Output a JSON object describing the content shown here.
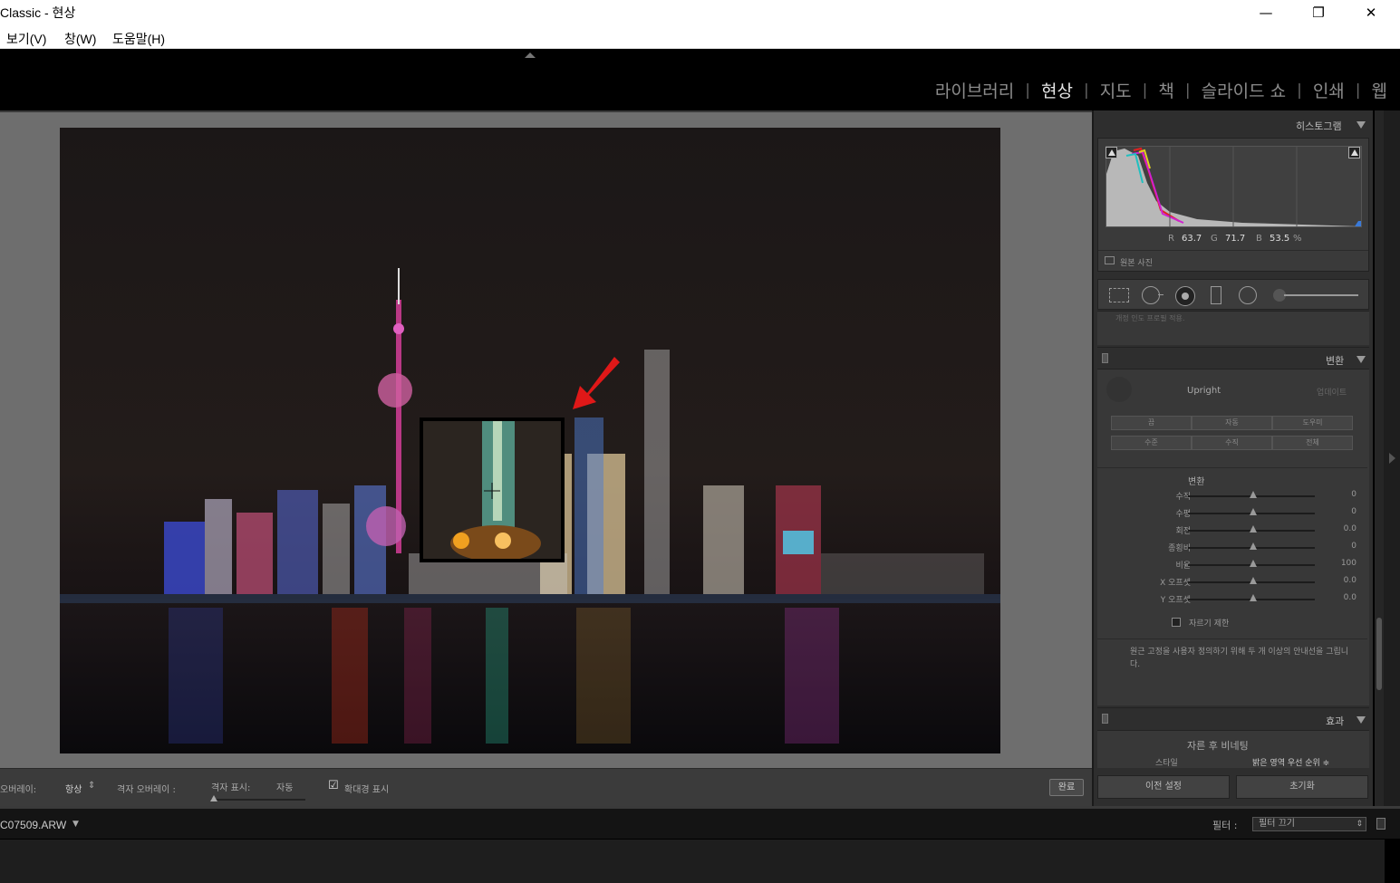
{
  "window": {
    "title": "Classic - 현상",
    "minimize_glyph": "—",
    "maximize_glyph": "❐",
    "close_glyph": "✕"
  },
  "menu": [
    "보기(V)",
    "창(W)",
    "도움말(H)"
  ],
  "modules": {
    "items": [
      "라이브러리",
      "현상",
      "지도",
      "책",
      "슬라이드 쇼",
      "인쇄",
      "웹"
    ],
    "active": "현상",
    "separator": "|"
  },
  "toolbar": {
    "overlay_label": "오버레이:",
    "overlay_value": "항상",
    "grid_overlay_label": "격자 오버레이 :",
    "grid_show_label": "격자 표시:",
    "grid_show_value": "자동",
    "loupe_label": "확대경 표시",
    "loupe_checked": true,
    "done_label": "완료"
  },
  "histogram": {
    "title": "히스토그램",
    "r_label": "R",
    "r_value": "63.7",
    "g_label": "G",
    "g_value": "71.7",
    "b_label": "B",
    "b_value": "53.5",
    "unit": "%",
    "original_photo_label": "원본 사진"
  },
  "clipped_text": "개정 인도 프로필 적용.",
  "transform": {
    "title": "변환",
    "upright_label": "Upright",
    "update_label": "업데이트",
    "buttons_row1": [
      "끔",
      "자동",
      "도우미"
    ],
    "buttons_row2": [
      "수준",
      "수직",
      "전체"
    ],
    "section_label": "변환",
    "sliders": [
      {
        "label": "수직",
        "value": "0"
      },
      {
        "label": "수평",
        "value": "0"
      },
      {
        "label": "회전",
        "value": "0.0"
      },
      {
        "label": "종횡비",
        "value": "0"
      },
      {
        "label": "비율",
        "value": "100"
      },
      {
        "label": "X 오프셋",
        "value": "0.0"
      },
      {
        "label": "Y 오프셋",
        "value": "0.0"
      }
    ],
    "constrain_crop_label": "자르기 제한",
    "hint": "원근 고정을 사용자 정의하기 위해 두 개 이상의 안내선을 그립니다."
  },
  "effects": {
    "title": "효과",
    "vignette_label": "자른 후 비네팅",
    "style_label": "스타일",
    "style_value": "밝은 영역 우선 순위 ≑"
  },
  "bottom_buttons": {
    "previous": "이전 설정",
    "reset": "초기화"
  },
  "filmstrip": {
    "filename": "C07509.ARW",
    "filter_label": "필터 :",
    "filter_value": "필터 끄기"
  },
  "colors": {
    "panel_bg": "#2e2e2e",
    "viewer_bg": "#6e6e6e",
    "annotation_arrow": "#e01818"
  }
}
